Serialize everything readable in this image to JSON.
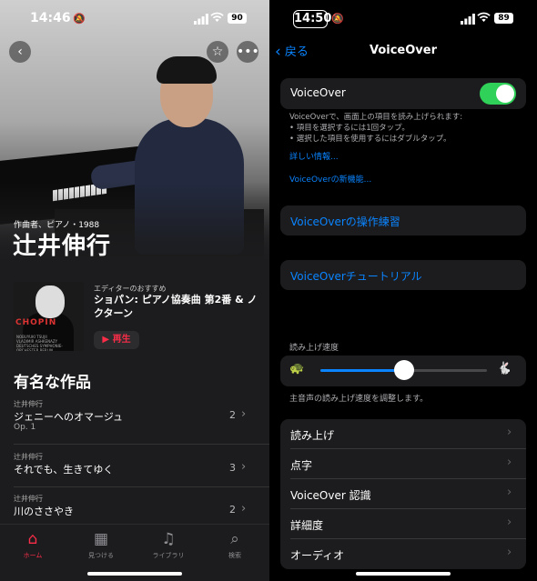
{
  "left": {
    "status": {
      "time": "14:46",
      "battery": "90"
    },
    "hero": {
      "subtitle": "作曲者、ピアノ・1988",
      "artist": "辻井伸行"
    },
    "recommendation": {
      "label": "エディターのおすすめ",
      "title": "ショパン: ピアノ協奏曲 第2番 & ノクターン",
      "play_label": "▶ 再生",
      "album_art_text": "CHOPIN",
      "album_small": [
        "NOBUYUKI TSUJII",
        "VLADIMIR ASHKENAZY",
        "DEUTSCHES SYMPHONIE-ORCHESTER BERLIN"
      ]
    },
    "section_title": "有名な作品",
    "works": [
      {
        "composer": "辻井伸行",
        "title": "ジェニーへのオマージュ",
        "sub": "Op. 1",
        "count": "2"
      },
      {
        "composer": "辻井伸行",
        "title": "それでも、生きてゆく",
        "sub": "",
        "count": "3"
      },
      {
        "composer": "辻井伸行",
        "title": "川のささやき",
        "sub": "",
        "count": "2"
      }
    ],
    "tabs": [
      {
        "label": "ホーム",
        "icon": "home-icon",
        "glyph": "⌂"
      },
      {
        "label": "見つける",
        "icon": "grid-icon",
        "glyph": "▦"
      },
      {
        "label": "ライブラリ",
        "icon": "library-icon",
        "glyph": "♫"
      },
      {
        "label": "検索",
        "icon": "search-icon",
        "glyph": "⌕"
      }
    ],
    "accent": "#fa2d48"
  },
  "right": {
    "status": {
      "time": "14:50",
      "battery": "89"
    },
    "nav": {
      "back": "戻る",
      "title": "VoiceOver"
    },
    "toggle_row": {
      "label": "VoiceOver",
      "on": true
    },
    "description": [
      "VoiceOverで、画面上の項目を読み上げられます:",
      "•  項目を選択するには1回タップ。",
      "•  選択した項目を使用するにはダブルタップ。"
    ],
    "links": {
      "details": "詳しい情報...",
      "new_features": "VoiceOverの新機能..."
    },
    "practice": "VoiceOverの操作練習",
    "tutorial": "VoiceOverチュートリアル",
    "speech_rate": {
      "label": "読み上げ速度",
      "value": 0.5,
      "description": "主音声の読み上げ速度を調整します。"
    },
    "settings_list": [
      "読み上げ",
      "点字",
      "VoiceOver 認識",
      "詳細度",
      "オーディオ"
    ],
    "accent": "#0a84ff",
    "toggle_color": "#30d158"
  }
}
